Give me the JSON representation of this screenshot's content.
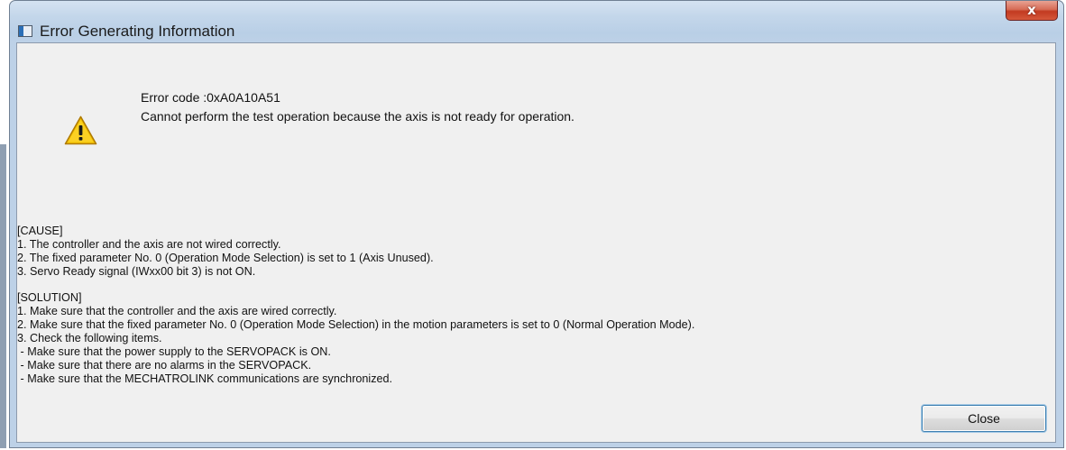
{
  "window": {
    "title": "Error Generating Information",
    "close_glyph": "x"
  },
  "message": {
    "icon": "warning-icon",
    "error_code": "Error code :0xA0A10A51",
    "text": "Cannot perform the test operation because the axis is not ready for operation."
  },
  "cause": {
    "heading": "[CAUSE]",
    "lines": [
      "1. The controller and the axis are not wired correctly.",
      "2. The fixed parameter No. 0 (Operation Mode Selection) is set to 1 (Axis Unused).",
      "3. Servo Ready signal (IWxx00 bit 3) is not ON."
    ]
  },
  "solution": {
    "heading": "[SOLUTION]",
    "lines": [
      "1. Make sure that the controller and the axis are wired correctly.",
      "2. Make sure that the fixed parameter No. 0 (Operation Mode Selection) in the motion parameters is set to 0 (Normal Operation Mode).",
      "3. Check the following items.",
      " - Make sure that the power supply to the SERVOPACK is ON.",
      " - Make sure that there are no alarms in the SERVOPACK.",
      " - Make sure that the MECHATROLINK communications are synchronized."
    ]
  },
  "buttons": {
    "close_label": "Close"
  },
  "colors": {
    "warning_fill": "#f5c400",
    "warning_outline": "#b07b00",
    "close_button_red": "#c23a21"
  }
}
